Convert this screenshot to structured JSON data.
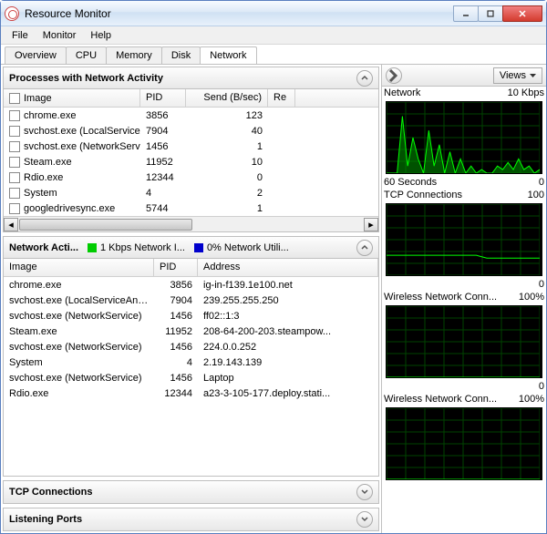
{
  "window": {
    "title": "Resource Monitor"
  },
  "menu": {
    "file": "File",
    "monitor": "Monitor",
    "help": "Help"
  },
  "tabs": {
    "overview": "Overview",
    "cpu": "CPU",
    "memory": "Memory",
    "disk": "Disk",
    "network": "Network"
  },
  "panels": {
    "processes": {
      "title": "Processes with Network Activity",
      "cols": {
        "image": "Image",
        "pid": "PID",
        "send": "Send (B/sec)",
        "recv": "Re"
      },
      "rows": [
        {
          "image": "chrome.exe",
          "pid": "3856",
          "send": "123"
        },
        {
          "image": "svchost.exe (LocalServiceAn...",
          "pid": "7904",
          "send": "40"
        },
        {
          "image": "svchost.exe (NetworkService)",
          "pid": "1456",
          "send": "1"
        },
        {
          "image": "Steam.exe",
          "pid": "11952",
          "send": "10"
        },
        {
          "image": "Rdio.exe",
          "pid": "12344",
          "send": "0"
        },
        {
          "image": "System",
          "pid": "4",
          "send": "2"
        },
        {
          "image": "googledrivesync.exe",
          "pid": "5744",
          "send": "1"
        }
      ]
    },
    "activity": {
      "title": "Network Acti...",
      "legend1": "1 Kbps Network I...",
      "legend2": "0% Network Utili...",
      "cols": {
        "image": "Image",
        "pid": "PID",
        "address": "Address"
      },
      "rows": [
        {
          "image": "chrome.exe",
          "pid": "3856",
          "address": "ig-in-f139.1e100.net"
        },
        {
          "image": "svchost.exe (LocalServiceAndNo...",
          "pid": "7904",
          "address": "239.255.255.250"
        },
        {
          "image": "svchost.exe (NetworkService)",
          "pid": "1456",
          "address": "ff02::1:3"
        },
        {
          "image": "Steam.exe",
          "pid": "11952",
          "address": "208-64-200-203.steampow..."
        },
        {
          "image": "svchost.exe (NetworkService)",
          "pid": "1456",
          "address": "224.0.0.252"
        },
        {
          "image": "System",
          "pid": "4",
          "address": "2.19.143.139"
        },
        {
          "image": "svchost.exe (NetworkService)",
          "pid": "1456",
          "address": "Laptop"
        },
        {
          "image": "Rdio.exe",
          "pid": "12344",
          "address": "a23-3-105-177.deploy.stati..."
        }
      ]
    },
    "tcp": {
      "title": "TCP Connections"
    },
    "listening": {
      "title": "Listening Ports"
    }
  },
  "right": {
    "views": "Views",
    "graphs": [
      {
        "tl": "Network",
        "tr": "10 Kbps",
        "bl": "60 Seconds",
        "br": "0"
      },
      {
        "tl": "TCP Connections",
        "tr": "100",
        "bl": "",
        "br": "0"
      },
      {
        "tl": "Wireless Network Conn...",
        "tr": "100%",
        "bl": "",
        "br": "0"
      },
      {
        "tl": "Wireless Network Conn...",
        "tr": "100%",
        "bl": "",
        "br": ""
      }
    ]
  },
  "chart_data": [
    {
      "type": "area",
      "title": "Network",
      "ylabel": "Kbps",
      "ylim": [
        0,
        10
      ],
      "xlim_seconds": [
        60,
        0
      ],
      "values": [
        0,
        0,
        0,
        8,
        1,
        5,
        2,
        0,
        6,
        1,
        4,
        0,
        3,
        0,
        2,
        0,
        1,
        0,
        0.5,
        0,
        0,
        1,
        0.5,
        1.5,
        0.5,
        2,
        0.5,
        1,
        0,
        0.5
      ]
    },
    {
      "type": "line",
      "title": "TCP Connections",
      "ylim": [
        0,
        100
      ],
      "xlim_seconds": [
        60,
        0
      ],
      "values": [
        28,
        28,
        28,
        28,
        28,
        28,
        28,
        28,
        28,
        28,
        28,
        28,
        28,
        28,
        28,
        28,
        28,
        28,
        26,
        24,
        24,
        24,
        24,
        24,
        24,
        24,
        24,
        24,
        24,
        24
      ]
    },
    {
      "type": "line",
      "title": "Wireless Network Connection",
      "ylabel": "%",
      "ylim": [
        0,
        100
      ],
      "xlim_seconds": [
        60,
        0
      ],
      "values": [
        0,
        0,
        0,
        0,
        0,
        0,
        0,
        0,
        0,
        0,
        0,
        0,
        0,
        0,
        0,
        0,
        0,
        0,
        0,
        0,
        0,
        0,
        0,
        0,
        0,
        0,
        0,
        0,
        0,
        0
      ]
    },
    {
      "type": "line",
      "title": "Wireless Network Connection",
      "ylabel": "%",
      "ylim": [
        0,
        100
      ],
      "xlim_seconds": [
        60,
        0
      ],
      "values": [
        0,
        0,
        0,
        0,
        0,
        0,
        0,
        0,
        0,
        0,
        0,
        0,
        0,
        0,
        0,
        0,
        0,
        0,
        0,
        0,
        0,
        0,
        0,
        0,
        0,
        0,
        0,
        0,
        0,
        0
      ]
    }
  ]
}
